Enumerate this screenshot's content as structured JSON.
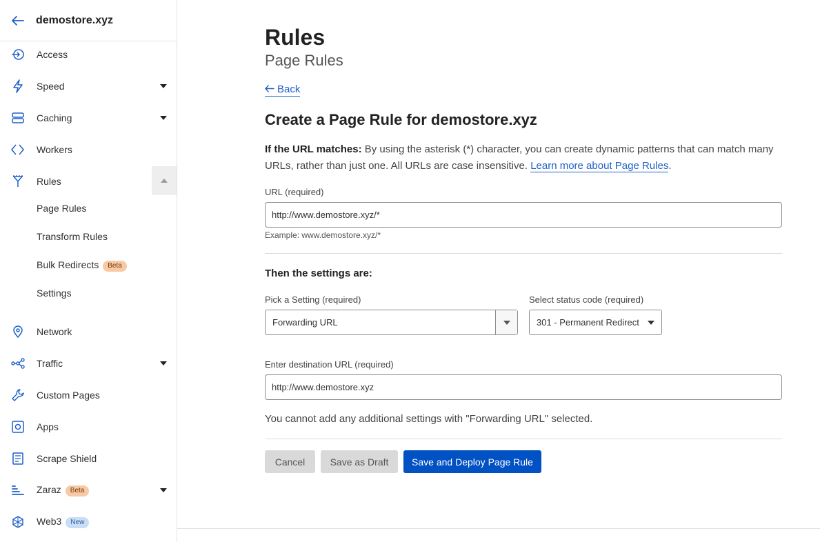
{
  "sidebar": {
    "site_name": "demostore.xyz",
    "items": [
      {
        "label": "Access",
        "icon": "access-icon"
      },
      {
        "label": "Speed",
        "icon": "lightning-icon",
        "expandable": true
      },
      {
        "label": "Caching",
        "icon": "caching-icon",
        "expandable": true
      },
      {
        "label": "Workers",
        "icon": "workers-icon"
      },
      {
        "label": "Rules",
        "icon": "rules-icon",
        "expanded": true
      },
      {
        "label": "Network",
        "icon": "location-pin-icon"
      },
      {
        "label": "Traffic",
        "icon": "traffic-icon",
        "expandable": true
      },
      {
        "label": "Custom Pages",
        "icon": "wrench-icon"
      },
      {
        "label": "Apps",
        "icon": "apps-icon"
      },
      {
        "label": "Scrape Shield",
        "icon": "document-icon"
      },
      {
        "label": "Zaraz",
        "icon": "zaraz-icon",
        "expandable": true,
        "badge": "Beta"
      },
      {
        "label": "Web3",
        "icon": "web3-icon",
        "badge": "New"
      }
    ],
    "rules_subitems": [
      {
        "label": "Page Rules"
      },
      {
        "label": "Transform Rules"
      },
      {
        "label": "Bulk Redirects",
        "badge": "Beta"
      },
      {
        "label": "Settings"
      }
    ]
  },
  "main": {
    "title": "Rules",
    "subtitle": "Page Rules",
    "back_label": "Back",
    "heading": "Create a Page Rule for demostore.xyz",
    "intro_bold": "If the URL matches:",
    "intro_text": " By using the asterisk (*) character, you can create dynamic patterns that can match many URLs, rather than just one. All URLs are case insensitive. ",
    "intro_link": "Learn more about Page Rules",
    "intro_end": ".",
    "url_label": "URL (required)",
    "url_value": "http://www.demostore.xyz/*",
    "url_example": "Example: www.demostore.xyz/*",
    "settings_heading": "Then the settings are:",
    "setting_label": "Pick a Setting (required)",
    "setting_value": "Forwarding URL",
    "status_label": "Select status code (required)",
    "status_value": "301 - Permanent Redirect",
    "dest_label": "Enter destination URL (required)",
    "dest_value": "http://www.demostore.xyz",
    "note": "You cannot add any additional settings with \"Forwarding URL\" selected.",
    "buttons": {
      "cancel": "Cancel",
      "draft": "Save as Draft",
      "deploy": "Save and Deploy Page Rule"
    }
  },
  "colors": {
    "accent": "#0051c3",
    "link": "#1e5fc8",
    "badge_beta": "#f8c9a3",
    "badge_new": "#c8ddf6"
  }
}
